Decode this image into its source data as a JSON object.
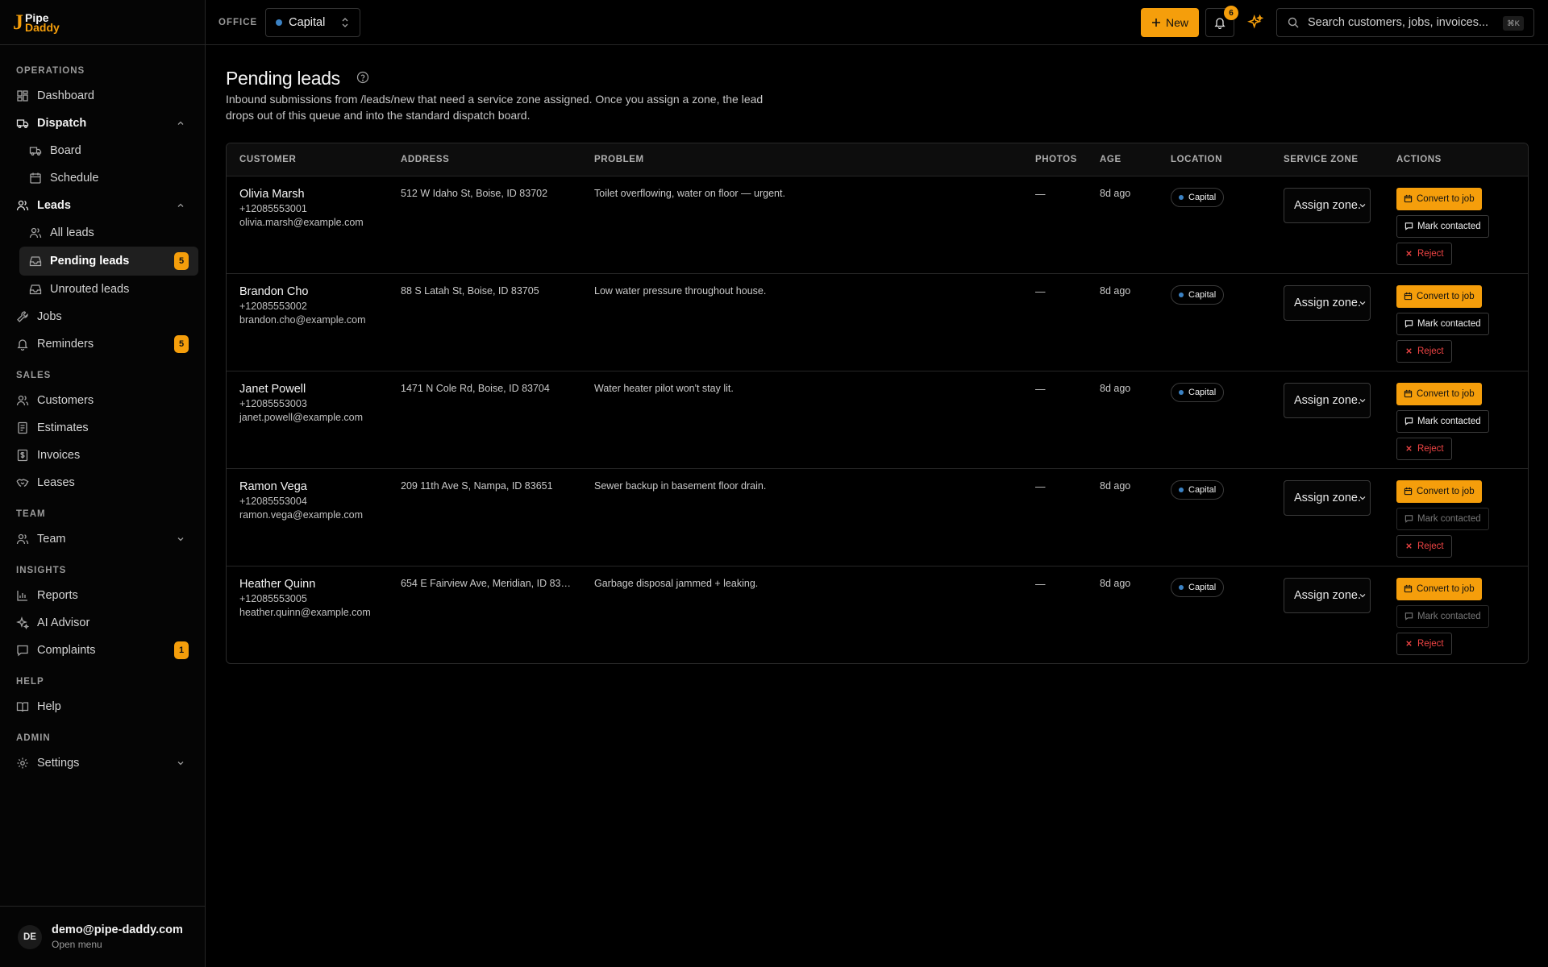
{
  "brand": {
    "line1": "Pipe",
    "line2": "Daddy",
    "accent": "#f59e0b"
  },
  "sidebar": {
    "sections": {
      "operations": "OPERATIONS",
      "sales": "SALES",
      "team": "TEAM",
      "insights": "INSIGHTS",
      "help": "HELP",
      "admin": "ADMIN"
    },
    "items": {
      "dashboard": "Dashboard",
      "dispatch": "Dispatch",
      "board": "Board",
      "schedule": "Schedule",
      "leads": "Leads",
      "all_leads": "All leads",
      "pending_leads": "Pending leads",
      "pending_leads_badge": "5",
      "unrouted_leads": "Unrouted leads",
      "jobs": "Jobs",
      "reminders": "Reminders",
      "reminders_badge": "5",
      "customers": "Customers",
      "estimates": "Estimates",
      "invoices": "Invoices",
      "leases": "Leases",
      "team": "Team",
      "reports": "Reports",
      "ai_advisor": "AI Advisor",
      "complaints": "Complaints",
      "complaints_badge": "1",
      "help": "Help",
      "settings": "Settings"
    },
    "user": {
      "initials": "DE",
      "email": "demo@pipe-daddy.com",
      "sub": "Open menu"
    }
  },
  "topbar": {
    "office_label": "OFFICE",
    "office_value": "Capital",
    "new_label": "New",
    "notifications_count": "6",
    "search_placeholder": "Search customers, jobs, invoices...",
    "search_shortcut": "⌘K"
  },
  "page": {
    "title": "Pending leads",
    "description": "Inbound submissions from /leads/new that need a service zone assigned. Once you assign a zone, the lead drops out of this queue and into the standard dispatch board."
  },
  "table": {
    "headers": {
      "customer": "CUSTOMER",
      "address": "ADDRESS",
      "problem": "PROBLEM",
      "photos": "PHOTOS",
      "age": "AGE",
      "location": "LOCATION",
      "service_zone": "SERVICE ZONE",
      "actions": "ACTIONS"
    },
    "action_labels": {
      "convert": "Convert to job",
      "contacted": "Mark contacted",
      "reject": "Reject"
    },
    "zone_placeholder": "Assign zone...",
    "rows": [
      {
        "name": "Olivia Marsh",
        "phone": "+12085553001",
        "email": "olivia.marsh@example.com",
        "address": "512 W Idaho St, Boise, ID 83702",
        "problem": "Toilet overflowing, water on floor — urgent.",
        "photos": "—",
        "age": "8d ago",
        "location": "Capital",
        "contacted_disabled": false
      },
      {
        "name": "Brandon Cho",
        "phone": "+12085553002",
        "email": "brandon.cho@example.com",
        "address": "88 S Latah St, Boise, ID 83705",
        "problem": "Low water pressure throughout house.",
        "photos": "—",
        "age": "8d ago",
        "location": "Capital",
        "contacted_disabled": false
      },
      {
        "name": "Janet Powell",
        "phone": "+12085553003",
        "email": "janet.powell@example.com",
        "address": "1471 N Cole Rd, Boise, ID 83704",
        "problem": "Water heater pilot won't stay lit.",
        "photos": "—",
        "age": "8d ago",
        "location": "Capital",
        "contacted_disabled": false
      },
      {
        "name": "Ramon Vega",
        "phone": "+12085553004",
        "email": "ramon.vega@example.com",
        "address": "209 11th Ave S, Nampa, ID 83651",
        "problem": "Sewer backup in basement floor drain.",
        "photos": "—",
        "age": "8d ago",
        "location": "Capital",
        "contacted_disabled": true
      },
      {
        "name": "Heather Quinn",
        "phone": "+12085553005",
        "email": "heather.quinn@example.com",
        "address": "654 E Fairview Ave, Meridian, ID 836...",
        "problem": "Garbage disposal jammed + leaking.",
        "photos": "—",
        "age": "8d ago",
        "location": "Capital",
        "contacted_disabled": true
      }
    ]
  },
  "colors": {
    "accent": "#f59e0b",
    "danger": "#ef4444",
    "office_dot": "#3b82c4"
  }
}
